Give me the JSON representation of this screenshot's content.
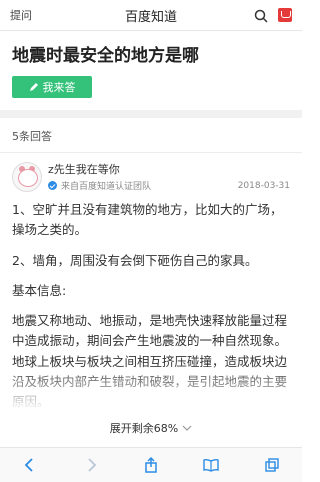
{
  "header": {
    "left_label": "提问",
    "title": "百度知道"
  },
  "question": {
    "title": "地震时最安全的地方是哪",
    "answer_button": "我来答"
  },
  "answers_count": "5条回答",
  "answer": {
    "author_name": "z先生我在等你",
    "source": "来自百度知道认证团队",
    "date": "2018-03-31",
    "paragraphs": [
      "1、空旷并且没有建筑物的地方，比如大的广场，操场之类的。",
      "2、墙角，周围没有会倒下砸伤自己的家具。",
      "基本信息:",
      "地震又称地动、地振动，是地壳快速释放能量过程中造成振动，期间会产生地震波的一种自然现象。地球上板块与板块之间相互挤压碰撞，造成板块边沿及板块内部产生错动和破裂，是引起地震的主要原因。"
    ]
  },
  "expand_label": "展开剩余68%",
  "colors": {
    "accent_green": "#34c27a",
    "bag_red": "#e43a3a",
    "link_blue": "#2b8ce6"
  },
  "icons": [
    "search-icon",
    "shopping-bag-icon",
    "pen-icon",
    "verified-icon",
    "chevron-down-icon",
    "back-icon",
    "forward-icon",
    "share-icon",
    "bookmarks-icon",
    "tabs-icon"
  ]
}
